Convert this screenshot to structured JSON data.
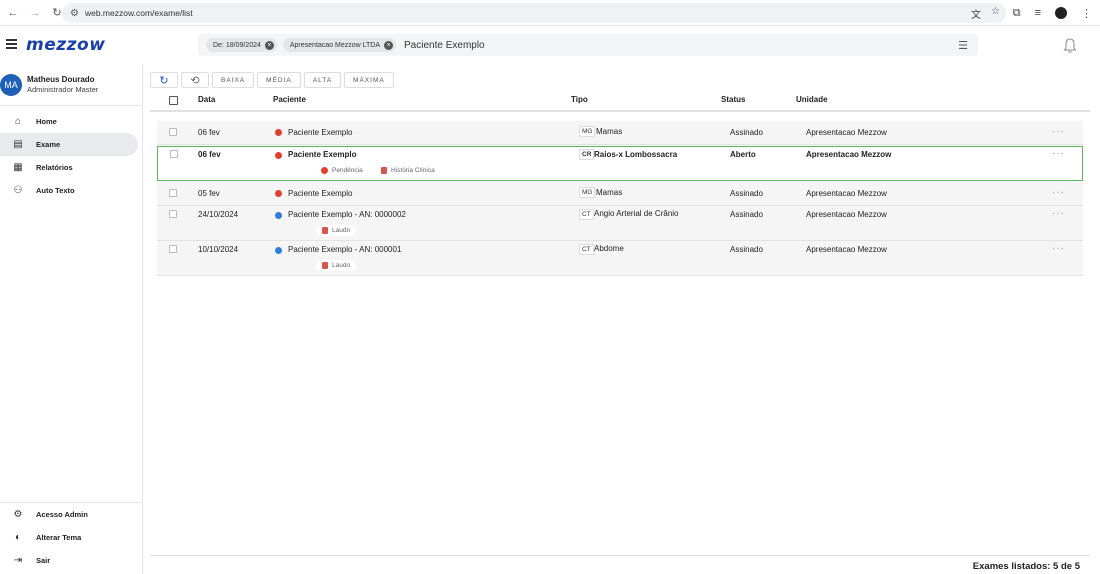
{
  "browser": {
    "url": "web.mezzow.com/exame/list"
  },
  "app": {
    "logo": "mezzow"
  },
  "search": {
    "chips": [
      {
        "label": "De: 18/09/2024"
      },
      {
        "label": "Apresentacao Mezzow LTDA"
      }
    ],
    "text": "Paciente Exemplo"
  },
  "user": {
    "initials": "MA",
    "name": "Matheus Dourado",
    "role": "Administrador Master"
  },
  "sidebar": {
    "items": [
      {
        "label": "Home",
        "icon": "home-icon"
      },
      {
        "label": "Exame",
        "icon": "exam-list-icon",
        "active": true
      },
      {
        "label": "Relatórios",
        "icon": "reports-icon"
      },
      {
        "label": "Auto Texto",
        "icon": "auto-text-icon"
      }
    ],
    "bottom_items": [
      {
        "label": "Acesso Admin",
        "icon": "gear-icon"
      },
      {
        "label": "Alterar Tema",
        "icon": "theme-icon"
      },
      {
        "label": "Sair",
        "icon": "logout-icon"
      }
    ]
  },
  "toolbar": {
    "priority_filters": [
      "BAIXA",
      "MÉDIA",
      "ALTA",
      "MÁXIMA"
    ]
  },
  "table": {
    "headers": {
      "data": "Data",
      "paciente": "Paciente",
      "tipo": "Tipo",
      "status": "Status",
      "unidade": "Unidade"
    },
    "rows": [
      {
        "date": "06 fev",
        "patient": "Paciente Exemplo",
        "dot_color": "#e0402f",
        "type_code": "MG",
        "type": "Mamas",
        "status": "Assinado",
        "unit": "Apresentacao Mezzow",
        "pills": []
      },
      {
        "date": "06 fev",
        "patient": "Paciente Exemplo",
        "dot_color": "#e0402f",
        "type_code": "CR",
        "type": "Raios-x Lombossacra",
        "status": "Aberto",
        "unit": "Apresentacao Mezzow",
        "selected": true,
        "pills": [
          {
            "label": "Pendência",
            "icon": "pending-icon"
          },
          {
            "label": "História Clínica",
            "icon": "clinical-history-icon"
          }
        ]
      },
      {
        "date": "05 fev",
        "patient": "Paciente Exemplo",
        "dot_color": "#e0402f",
        "type_code": "MG",
        "type": "Mamas",
        "status": "Assinado",
        "unit": "Apresentacao Mezzow",
        "pills": []
      },
      {
        "date": "24/10/2024",
        "patient": "Paciente Exemplo - AN: 0000002",
        "dot_color": "#2f7fd6",
        "type_code": "CT",
        "type": "Angio Arterial de Crânio",
        "status": "Assinado",
        "unit": "Apresentacao Mezzow",
        "pills": [
          {
            "label": "Laudo",
            "icon": "report-doc-icon"
          }
        ]
      },
      {
        "date": "10/10/2024",
        "patient": "Paciente Exemplo - AN: 000001",
        "dot_color": "#2f7fd6",
        "type_code": "CT",
        "type": "Abdome",
        "status": "Assinado",
        "unit": "Apresentacao Mezzow",
        "pills": [
          {
            "label": "Laudo",
            "icon": "report-doc-icon"
          }
        ]
      }
    ]
  },
  "footer": {
    "count_text": "Exames listados: 5 de 5"
  },
  "colors": {
    "brand": "#1a3fa8",
    "avatar": "#1e5fb8",
    "selected_border": "#5cb85c",
    "pending": "#e0402f",
    "document": "#d9534f"
  }
}
